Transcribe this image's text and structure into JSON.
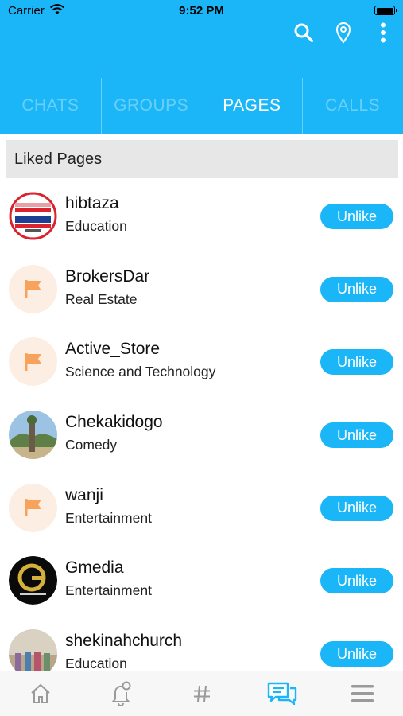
{
  "status_bar": {
    "carrier": "Carrier",
    "time": "9:52 PM",
    "icons": [
      "wifi-icon",
      "battery-icon"
    ]
  },
  "header": {
    "icons": [
      "search-icon",
      "location-pin-icon",
      "more-vertical-icon"
    ],
    "tabs": [
      {
        "label": "CHATS",
        "active": false
      },
      {
        "label": "GROUPS",
        "active": false
      },
      {
        "label": "PAGES",
        "active": true
      },
      {
        "label": "CALLS",
        "active": false
      }
    ]
  },
  "section": {
    "title": "Liked Pages"
  },
  "pages": [
    {
      "name": "hibtaza",
      "category": "Education",
      "avatar": "logo-avatar",
      "action": "Unlike"
    },
    {
      "name": "BrokersDar",
      "category": "Real Estate",
      "avatar": "flag-icon",
      "action": "Unlike"
    },
    {
      "name": "Active_Store",
      "category": "Science and Technology",
      "avatar": "flag-icon",
      "action": "Unlike"
    },
    {
      "name": "Chekakidogo",
      "category": "Comedy",
      "avatar": "photo-avatar",
      "action": "Unlike"
    },
    {
      "name": "wanji",
      "category": "Entertainment",
      "avatar": "flag-icon",
      "action": "Unlike"
    },
    {
      "name": "Gmedia",
      "category": "Entertainment",
      "avatar": "logo-avatar",
      "action": "Unlike"
    },
    {
      "name": "shekinahchurch",
      "category": "Education",
      "avatar": "photo-avatar",
      "action": "Unlike"
    }
  ],
  "bottom_nav": {
    "items": [
      "home-icon",
      "notifications-icon",
      "hashtag-icon",
      "messages-icon",
      "menu-icon"
    ],
    "active": "messages-icon"
  },
  "colors": {
    "accent": "#1ab6f7",
    "flag": "#f7a35c",
    "flag_bg": "#fdeee3",
    "section_bg": "#e7e7e7",
    "nav_inactive": "#9a9a9a"
  }
}
